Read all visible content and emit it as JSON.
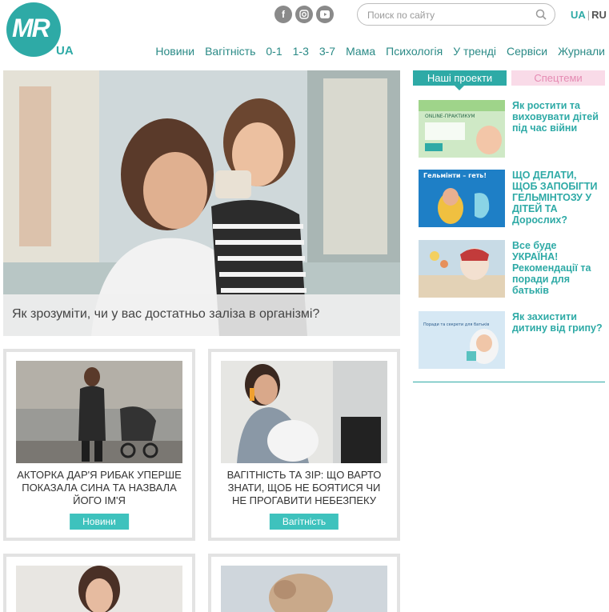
{
  "brand": {
    "logo_main": "MR",
    "logo_sub": "UA"
  },
  "social": [
    "facebook-icon",
    "instagram-icon",
    "youtube-icon"
  ],
  "search": {
    "placeholder": "Поиск по сайту"
  },
  "lang": {
    "ua": "UA",
    "ru": "RU"
  },
  "nav": [
    "Новини",
    "Вагітність",
    "0-1",
    "1-3",
    "3-7",
    "Мама",
    "Психологія",
    "У тренді",
    "Сервіси",
    "Журнали"
  ],
  "hero": {
    "caption": "Як зрозуміти, чи у вас достатньо заліза в організмі?"
  },
  "cards": [
    {
      "title": "АКТОРКА ДАР'Я РИБАК УПЕРШЕ ПОКАЗАЛА СИНА ТА НАЗВАЛА ЙОГО ІМ'Я",
      "tag": "Новини"
    },
    {
      "title": "ВАГІТНІСТЬ ТА ЗІР: ЩО ВАРТО ЗНАТИ, ЩОБ НЕ БОЯТИСЯ ЧИ НЕ ПРОГАВИТИ НЕБЕЗПЕКУ",
      "tag": "Вагітність"
    }
  ],
  "sidebar": {
    "tab_active": "Наші проекти",
    "tab_inactive": "Спецтеми",
    "projects": [
      {
        "title": "Як ростити та виховувати дітей під час війни",
        "img_text": "ONLINE-ПРАКТИКУМ"
      },
      {
        "title": "ЩО ДЕЛАТИ, ЩОБ ЗАПОБІГТИ ГЕЛЬМІНТОЗУ У ДІТЕЙ ТА Дорослих?",
        "img_text": "Гельмінти – геть!"
      },
      {
        "title": "Все буде УКРАЇНА! Рекомендації та поради для батьків",
        "img_text": ""
      },
      {
        "title": "Як захистити дитину від грипу?",
        "img_text": "Поради та секрети для батьків"
      }
    ]
  },
  "colors": {
    "accent": "#2eaaa6",
    "tag_bg": "#3ec2bd",
    "pink": "#f9dbe8"
  }
}
